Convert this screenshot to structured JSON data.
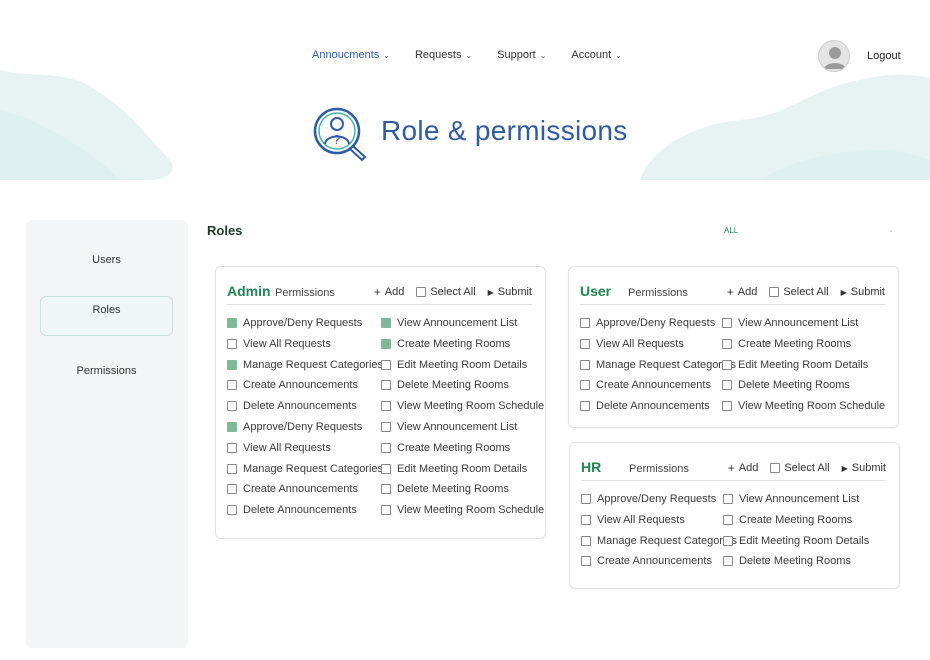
{
  "nav": {
    "items": [
      {
        "label": "Annoucments",
        "active": true
      },
      {
        "label": "Requests",
        "active": false
      },
      {
        "label": "Support",
        "active": false
      },
      {
        "label": "Account",
        "active": false
      }
    ],
    "logout_label": "Logout"
  },
  "page_title": "Role & permissions",
  "colors": {
    "accent": "#1e8a4f",
    "title_blue": "#2f5aa8",
    "checked": "#7fb99a",
    "wave": "#e6f3f2"
  },
  "sidebar": {
    "items": [
      {
        "label": "Users",
        "active": false
      },
      {
        "label": "Roles",
        "active": true
      },
      {
        "label": "Permissions",
        "active": false
      }
    ]
  },
  "main": {
    "heading": "Roles",
    "filter_value": "ALL"
  },
  "cards": [
    {
      "role": "Admin",
      "permissions_label": "Permissions",
      "add_label": "Add",
      "select_all_label": "Select All",
      "submit_label": "Submit",
      "left": [
        {
          "label": "Approve/Deny Requests",
          "checked": true
        },
        {
          "label": "View All Requests",
          "checked": false
        },
        {
          "label": "Manage Request Categories",
          "checked": true
        },
        {
          "label": "Create Announcements",
          "checked": false
        },
        {
          "label": "Delete Announcements",
          "checked": false
        },
        {
          "label": "Approve/Deny Requests",
          "checked": true
        },
        {
          "label": "View All Requests",
          "checked": false
        },
        {
          "label": "Manage Request Categories",
          "checked": false
        },
        {
          "label": "Create Announcements",
          "checked": false
        },
        {
          "label": "Delete Announcements",
          "checked": false
        }
      ],
      "right": [
        {
          "label": "View Announcement List",
          "checked": true
        },
        {
          "label": "Create Meeting Rooms",
          "checked": true
        },
        {
          "label": "Edit Meeting Room Details",
          "checked": false
        },
        {
          "label": "Delete Meeting Rooms",
          "checked": false
        },
        {
          "label": "View Meeting Room Schedule",
          "checked": false
        },
        {
          "label": "View Announcement List",
          "checked": false
        },
        {
          "label": "Create Meeting Rooms",
          "checked": false
        },
        {
          "label": "Edit Meeting Room Details",
          "checked": false
        },
        {
          "label": "Delete Meeting Rooms",
          "checked": false
        },
        {
          "label": "View Meeting Room Schedule",
          "checked": false
        }
      ]
    },
    {
      "role": "User",
      "permissions_label": "Permissions",
      "add_label": "Add",
      "select_all_label": "Select All",
      "submit_label": "Submit",
      "left": [
        {
          "label": "Approve/Deny Requests",
          "checked": false
        },
        {
          "label": "View All Requests",
          "checked": false
        },
        {
          "label": "Manage Request Categories",
          "checked": false
        },
        {
          "label": "Create Announcements",
          "checked": false
        },
        {
          "label": "Delete Announcements",
          "checked": false
        }
      ],
      "right": [
        {
          "label": "View Announcement List",
          "checked": false
        },
        {
          "label": "Create Meeting Rooms",
          "checked": false
        },
        {
          "label": "Edit Meeting Room Details",
          "checked": false
        },
        {
          "label": "Delete Meeting Rooms",
          "checked": false
        },
        {
          "label": "View Meeting Room Schedule",
          "checked": false
        }
      ]
    },
    {
      "role": "HR",
      "permissions_label": "Permissions",
      "add_label": "Add",
      "select_all_label": "Select All",
      "submit_label": "Submit",
      "left": [
        {
          "label": "Approve/Deny Requests",
          "checked": false
        },
        {
          "label": "View All Requests",
          "checked": false
        },
        {
          "label": "Manage Request Categories",
          "checked": false
        },
        {
          "label": "Create Announcements",
          "checked": false
        }
      ],
      "right": [
        {
          "label": "View Announcement List",
          "checked": false
        },
        {
          "label": "Create Meeting Rooms",
          "checked": false
        },
        {
          "label": "Edit Meeting Room Details",
          "checked": false
        },
        {
          "label": "Delete Meeting Rooms",
          "checked": false
        }
      ]
    }
  ]
}
